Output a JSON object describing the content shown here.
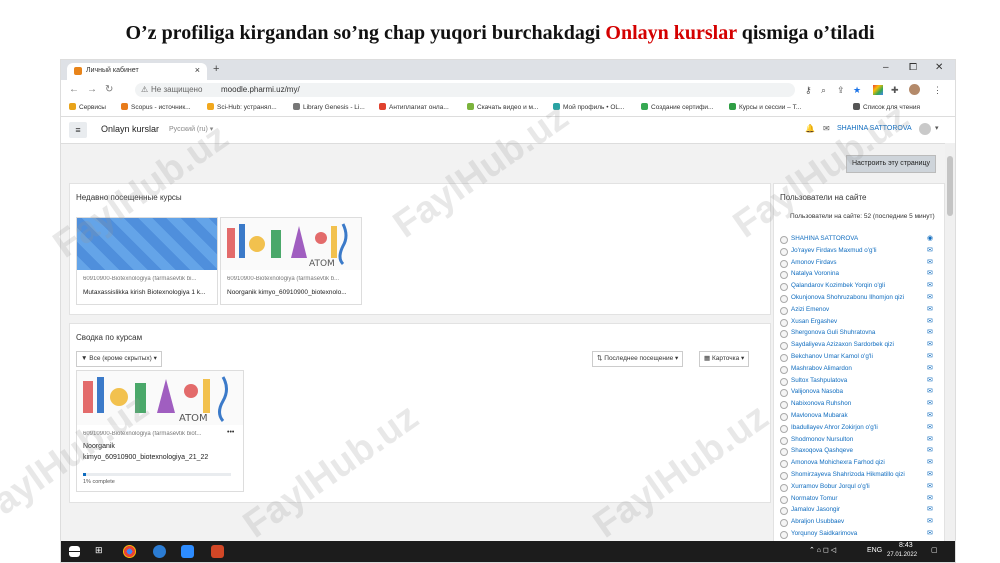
{
  "caption": {
    "before": "O’z profiliga kirgandan so’ng chap yuqori burchakdagi ",
    "highlight": "Onlayn kurslar",
    "after": " qismiga o’tiladi",
    "highlight_color": "#d40000"
  },
  "browser": {
    "tab_title": "Личный кабинет",
    "tab_close": "×",
    "new_tab": "+",
    "window_min": "–",
    "window_max": "⧠",
    "window_close": "✕",
    "not_secure": "Не защищено",
    "url": "moodle.pharmi.uz/my/",
    "bookmarks": [
      {
        "label": "Сервисы",
        "color": "#e8a31a"
      },
      {
        "label": "Scopus - источник...",
        "color": "#e87b1a"
      },
      {
        "label": "Sci-Hub: устранял...",
        "color": "#f1a81e"
      },
      {
        "label": "Library Genesis - Li...",
        "color": "#777777"
      },
      {
        "label": "Антиплагиат онла...",
        "color": "#e0412e"
      },
      {
        "label": "Скачать видео и м...",
        "color": "#7bb33c"
      },
      {
        "label": "Мой профиль • OL...",
        "color": "#2aa3a3"
      },
      {
        "label": "Создание сертифи...",
        "color": "#36a852"
      },
      {
        "label": "Курсы и сессии – T...",
        "color": "#2f9e44"
      }
    ],
    "reading_list": "Список для чтения"
  },
  "moodle": {
    "brand": "Onlayn kurslar",
    "language": "Русский (ru) ▾",
    "user_name": "SHAHINA SATTOROVA",
    "customize_button": "Настроить эту страницу",
    "recent_title": "Недавно посещенные курсы",
    "recent_courses": [
      {
        "category": "60910900-Biotexnologiya (farmasevtik bi...",
        "name": "Mutaxassislikka kirish Biotexnologiya 1 k..."
      },
      {
        "category": "60910900-Biotexnologiya (farmasevtik b...",
        "name": "Noorganik kimyo_60910900_biotexnolo..."
      }
    ],
    "overview_title": "Сводка по курсам",
    "filter_select": "Все (кроме скрытых)",
    "sort_select": "Последнее посещение",
    "view_select": "Карточка",
    "overview_course": {
      "category": "60910900-Biotexnologiya (farmasevtik biot...",
      "name_line1": "Noorganik",
      "name_line2": "kimyo_60910900_biotexnologiya_21_22",
      "progress_text": "1% complete",
      "progress": 0.01,
      "menu": "•••"
    },
    "users_block": {
      "title": "Пользователи на сайте",
      "online_text": "Пользователи на сайте: 52 (последние 5 минут)",
      "users": [
        "SHAHINA SATTOROVA",
        "Jo'rayev Firdavs Maxmud o'g'li",
        "Amonov Firdavs",
        "Natalya Voronina",
        "Qalandarov Kozimbek Yorqin o'gli",
        "Okunjonova Shohruzabonu Ilhomjon qizi",
        "Azizi Emenov",
        "Xusan Ergashev",
        "Shergonova Guli Shuhratovna",
        "Saydaliyeva Azizaxon Sardorbek qizi",
        "Bekchanov Umar Kamol o'g'li",
        "Mashrabov Alimardon",
        "Sultox Tashpulatova",
        "Valijonova Nasoba",
        "Nabixonova Ruhshon",
        "Mavlonova Mubarak",
        "Ibadullayev Ahror Zokirjon o'g'li",
        "Shodmonov Nursulton",
        "Shaxoqova Qashqeve",
        "Amonova Mohichexra Farhod qizi",
        "Shomirzayeva Shahrizoda Hikmatillo qizi",
        "Xurramov Bobur Jorqul o'g'li",
        "Normatov Tomur",
        "Jamalov Jasongir",
        "Abraljon Usubbaev",
        "Yorqunoy Saidkarimova"
      ]
    }
  },
  "taskbar": {
    "lang": "ENG",
    "time": "8:43",
    "date": "27.01.2022"
  },
  "watermark": "FaylHub.uz"
}
